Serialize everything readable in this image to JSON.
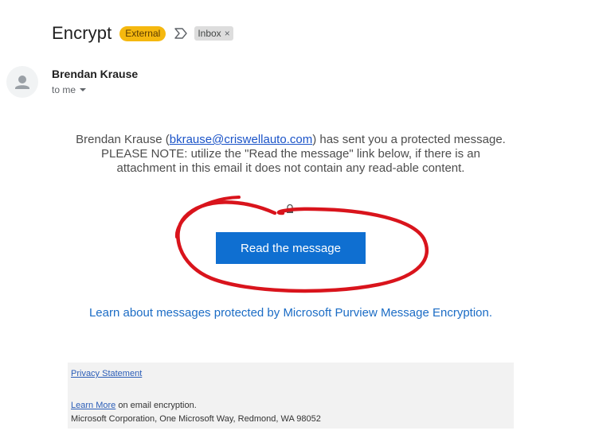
{
  "header": {
    "subject": "Encrypt",
    "external_badge": "External",
    "inbox_label": "Inbox",
    "inbox_remove": "×"
  },
  "sender": {
    "name": "Brendan Krause",
    "recipient": "to me"
  },
  "body": {
    "intro_before": "Brendan Krause (",
    "sender_email": "bkrause@criswellauto.com",
    "intro_after": ") has sent you a protected message. PLEASE NOTE: utilize the \"Read the message\" link below, if there is an attachment in this email it does not contain any read-able content.",
    "read_button": "Read the message",
    "learn_link": "Learn about messages protected by Microsoft Purview Message Encryption."
  },
  "footer": {
    "privacy": "Privacy Statement",
    "learn_more": "Learn More",
    "learn_more_suffix": " on email encryption.",
    "address": "Microsoft Corporation, One Microsoft Way, Redmond, WA 98052"
  },
  "colors": {
    "external_badge": "#f5b80f",
    "button": "#0f6fd1",
    "annotation": "#d9141c",
    "link": "#1b6cc5"
  },
  "icons": {
    "avatar": "person-icon",
    "important": "important-marker-icon",
    "lock": "lock-icon",
    "caret": "caret-down-icon"
  }
}
